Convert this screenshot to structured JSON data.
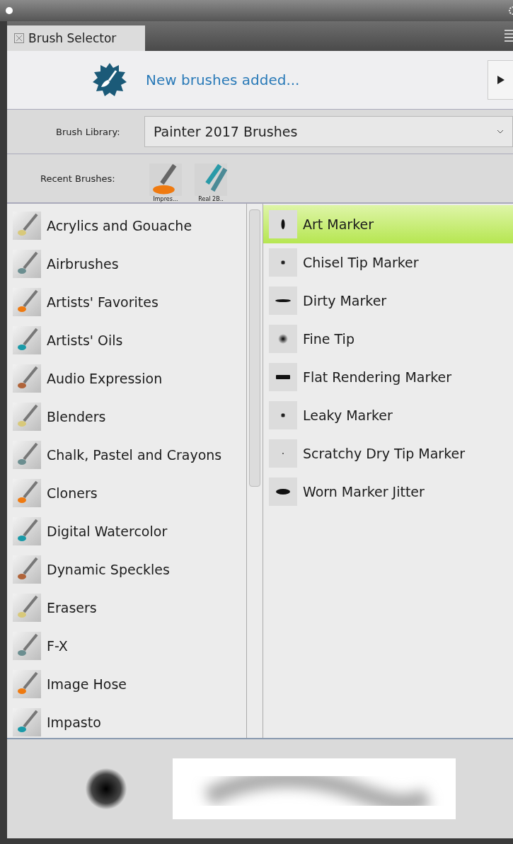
{
  "panel": {
    "tab": "Brush Selector"
  },
  "banner": {
    "link": "New brushes added..."
  },
  "library": {
    "label": "Brush Library:",
    "value": "Painter 2017 Brushes"
  },
  "recent": {
    "label": "Recent Brushes:",
    "items": [
      {
        "label": "Impres..."
      },
      {
        "label": "Real 2B.."
      }
    ]
  },
  "categories": [
    {
      "name": "Acrylics and Gouache",
      "selected": false
    },
    {
      "name": "Airbrushes",
      "selected": false
    },
    {
      "name": "Artists' Favorites",
      "selected": false
    },
    {
      "name": "Artists' Oils",
      "selected": false
    },
    {
      "name": "Audio Expression",
      "selected": false
    },
    {
      "name": "Blenders",
      "selected": false
    },
    {
      "name": "Chalk, Pastel and Crayons",
      "selected": false
    },
    {
      "name": "Cloners",
      "selected": false
    },
    {
      "name": "Digital Watercolor",
      "selected": false
    },
    {
      "name": "Dynamic Speckles",
      "selected": false
    },
    {
      "name": "Erasers",
      "selected": false
    },
    {
      "name": "F-X",
      "selected": false
    },
    {
      "name": "Image Hose",
      "selected": false
    },
    {
      "name": "Impasto",
      "selected": false
    }
  ],
  "variants": [
    {
      "name": "Art Marker",
      "selected": true,
      "kind": "tall"
    },
    {
      "name": "Chisel Tip Marker",
      "selected": false,
      "kind": "dot"
    },
    {
      "name": "Dirty Marker",
      "selected": false,
      "kind": "dash"
    },
    {
      "name": "Fine Tip",
      "selected": false,
      "kind": "soft"
    },
    {
      "name": "Flat Rendering Marker",
      "selected": false,
      "kind": "bar"
    },
    {
      "name": "Leaky Marker",
      "selected": false,
      "kind": "dot"
    },
    {
      "name": "Scratchy Dry Tip Marker",
      "selected": false,
      "kind": "tiny"
    },
    {
      "name": "Worn Marker Jitter",
      "selected": false,
      "kind": "blob"
    }
  ]
}
